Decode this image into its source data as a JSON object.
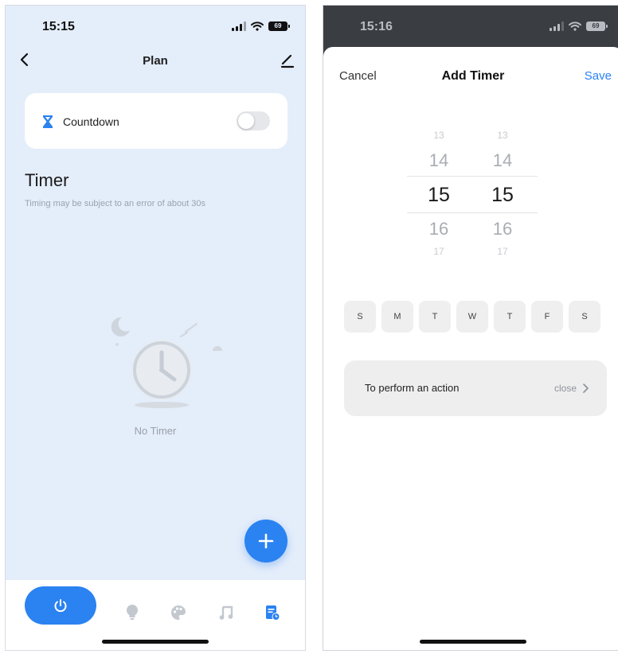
{
  "left_screen": {
    "status_bar": {
      "time": "15:15",
      "battery": "69"
    },
    "header": {
      "title": "Plan"
    },
    "countdown": {
      "label": "Countdown",
      "enabled": false
    },
    "timer_section": {
      "title": "Timer",
      "subtitle": "Timing may be subject to an error of about 30s"
    },
    "empty_state": {
      "text": "No Timer"
    },
    "tab_bar": {
      "active_tab": "power",
      "tabs": [
        "power-icon",
        "bulb-icon",
        "palette-icon",
        "music-icon",
        "timer-schedule-icon"
      ]
    },
    "accent_color": "#2b82f1",
    "background_color": "#e4edfa"
  },
  "right_screen": {
    "status_bar": {
      "time": "15:16",
      "battery": "69"
    },
    "sheet": {
      "cancel_label": "Cancel",
      "title": "Add Timer",
      "save_label": "Save"
    },
    "time_picker": {
      "hours": [
        "13",
        "14",
        "15",
        "16",
        "17"
      ],
      "minutes": [
        "13",
        "14",
        "15",
        "16",
        "17"
      ],
      "selected_hour": "15",
      "selected_minute": "15"
    },
    "weekdays": [
      "S",
      "M",
      "T",
      "W",
      "T",
      "F",
      "S"
    ],
    "action": {
      "label": "To perform an action",
      "value": "close"
    },
    "accent_color": "#2b82f1"
  }
}
